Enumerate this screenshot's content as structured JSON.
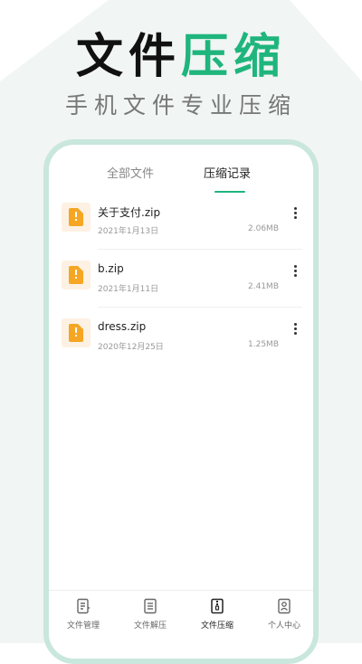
{
  "hero": {
    "title_dark": "文件",
    "title_accent": "压缩",
    "subtitle": "手机文件专业压缩"
  },
  "tabs": [
    {
      "label": "全部文件",
      "active": false
    },
    {
      "label": "压缩记录",
      "active": true
    }
  ],
  "files": [
    {
      "name": "关于支付.zip",
      "date": "2021年1月13日",
      "size": "2.06MB",
      "icon": "zip-file-icon"
    },
    {
      "name": "b.zip",
      "date": "2021年1月11日",
      "size": "2.41MB",
      "icon": "zip-file-icon"
    },
    {
      "name": "dress.zip",
      "date": "2020年12月25日",
      "size": "1.25MB",
      "icon": "zip-file-icon"
    }
  ],
  "bottom_nav": [
    {
      "label": "文件管理",
      "icon": "document-list-icon",
      "active": false
    },
    {
      "label": "文件解压",
      "icon": "document-lines-icon",
      "active": false
    },
    {
      "label": "文件压缩",
      "icon": "archive-zipper-icon",
      "active": true
    },
    {
      "label": "个人中心",
      "icon": "person-card-icon",
      "active": false
    }
  ],
  "colors": {
    "accent": "#1fb57d",
    "phone_frame": "#c9e7dc",
    "background_tint": "#f1f5f4",
    "file_icon_bg": "#fdf1e3",
    "file_icon": "#f5a623"
  }
}
